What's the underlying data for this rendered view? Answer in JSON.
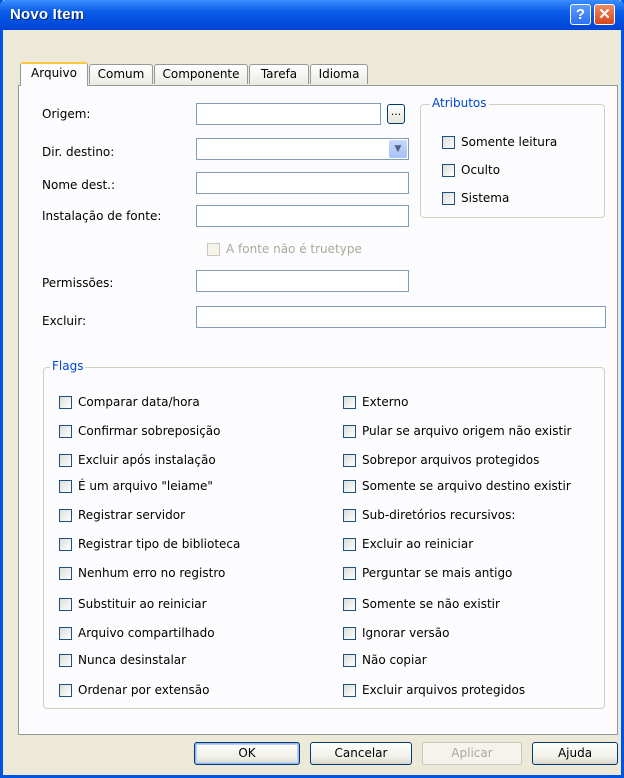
{
  "window": {
    "title": "Novo Item"
  },
  "tabs": [
    "Arquivo",
    "Comum",
    "Componente",
    "Tarefa",
    "Idioma"
  ],
  "form": {
    "origem": {
      "label": "Origem:",
      "value": "",
      "browse": "..."
    },
    "dir_destino": {
      "label": "Dir. destino:",
      "value": ""
    },
    "nome_dest": {
      "label": "Nome dest.:",
      "value": ""
    },
    "instalacao_fonte": {
      "label": "Instalação de fonte:",
      "value": ""
    },
    "nao_truetype": {
      "label": "A fonte não é truetype"
    },
    "permissoes": {
      "label": "Permissões:",
      "value": ""
    },
    "excluir": {
      "label": "Excluir:",
      "value": ""
    }
  },
  "atributos": {
    "title": "Atributos",
    "items": [
      "Somente leitura",
      "Oculto",
      "Sistema"
    ]
  },
  "flags": {
    "title": "Flags",
    "left": [
      "Comparar data/hora",
      "Confirmar sobreposição",
      "Excluir após instalação",
      "É um arquivo \"leiame\"",
      "Registrar servidor",
      "Registrar tipo de biblioteca",
      "Nenhum erro no registro",
      "Substituir ao reiniciar",
      "Arquivo compartilhado",
      "Nunca desinstalar",
      "Ordenar por extensão"
    ],
    "right": [
      "Externo",
      "Pular se arquivo origem não existir",
      "Sobrepor arquivos protegidos",
      "Somente se arquivo destino existir",
      "Sub-diretórios recursivos:",
      "Excluir ao reiniciar",
      "Perguntar se mais antigo",
      "Somente se não existir",
      "Ignorar versão",
      "Não copiar",
      "Excluir arquivos protegidos"
    ]
  },
  "buttons": {
    "ok": "OK",
    "cancel": "Cancelar",
    "apply": "Aplicar",
    "help": "Ajuda"
  },
  "colors": {
    "title_bar": "#0a5ce8",
    "group_title": "#0046d5",
    "dialog_bg": "#ece9d8"
  }
}
